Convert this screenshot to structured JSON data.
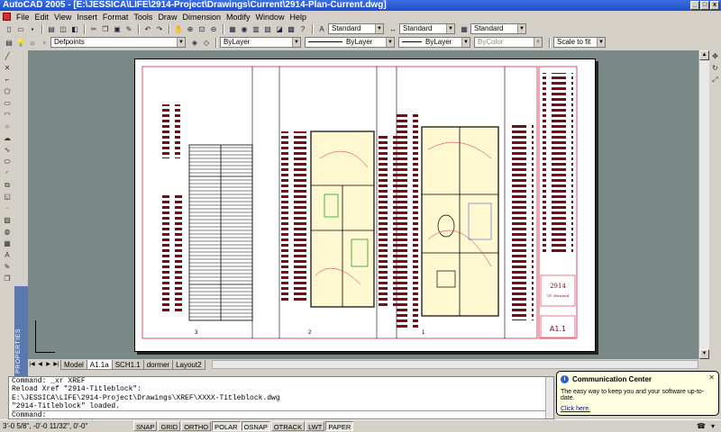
{
  "window": {
    "title": "AutoCAD 2005 - [E:\\JESSICA\\LIFE\\2914-Project\\Drawings\\Current\\2914-Plan-Current.dwg]",
    "min_label": "_",
    "max_label": "□",
    "close_label": "x"
  },
  "menu": [
    "File",
    "Edit",
    "View",
    "Insert",
    "Format",
    "Tools",
    "Draw",
    "Dimension",
    "Modify",
    "Window",
    "Help"
  ],
  "styles": {
    "text_style": "Standard",
    "dim_style": "Standard",
    "table_style": "Standard"
  },
  "properties": {
    "layer": "Defpoints",
    "color": "ByLayer",
    "linetype": "ByLayer",
    "lineweight": "ByLayer",
    "plotstyle": "ByColor",
    "plot_scale": "Scale to fit"
  },
  "drawing": {
    "sheet_number": "A1.1",
    "project_number": "2914",
    "subtitle": "1F. Westend",
    "view_numbers": [
      "3",
      "2",
      "1"
    ],
    "colors": {
      "linework": "#000000",
      "annotation": "#7a0a1a",
      "border": "#e02040",
      "paper": "#ffffff",
      "canvas": "#7b8888"
    }
  },
  "tabs": [
    {
      "label": "Model",
      "active": false
    },
    {
      "label": "A1.1a",
      "active": true
    },
    {
      "label": "SCH1.1",
      "active": false
    },
    {
      "label": "dormer",
      "active": false
    },
    {
      "label": "Layout2",
      "active": false
    }
  ],
  "palette_label": "PROPERTIES",
  "command_lines": [
    "Command: _xr XREF",
    "Reload Xref \"2914-Titleblock\":",
    "E:\\JESSICA\\LIFE\\2914-Project\\Drawings\\XREF\\XXXX-Titleblock.dwg",
    "\"2914-Titleblock\" loaded."
  ],
  "command_prompt": "Command:",
  "comm_center": {
    "title": "Communication Center",
    "body": "The easy way to keep you and your software up-to-date.",
    "link": "Click here."
  },
  "status": {
    "coords": "3'-0 5/8\",  -0'-0 11/32\", 0'-0\"",
    "buttons": [
      {
        "label": "SNAP",
        "pressed": false
      },
      {
        "label": "GRID",
        "pressed": false
      },
      {
        "label": "ORTHO",
        "pressed": false
      },
      {
        "label": "POLAR",
        "pressed": true
      },
      {
        "label": "OSNAP",
        "pressed": true
      },
      {
        "label": "OTRACK",
        "pressed": false
      },
      {
        "label": "LWT",
        "pressed": false
      },
      {
        "label": "PAPER",
        "pressed": true
      }
    ]
  }
}
